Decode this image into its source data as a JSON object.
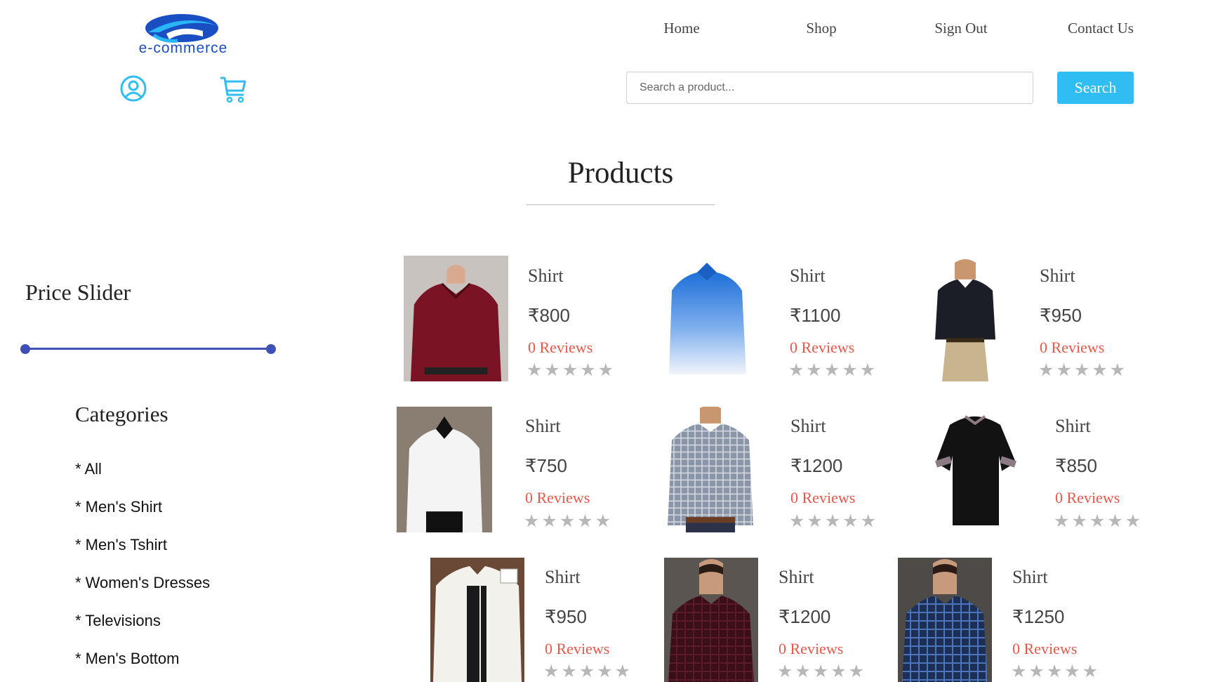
{
  "header": {
    "logo_text": "e-commerce",
    "nav": [
      {
        "label": "Home"
      },
      {
        "label": "Shop"
      },
      {
        "label": "Sign Out"
      },
      {
        "label": "Contact Us"
      }
    ],
    "icons": [
      "user-icon",
      "cart-icon"
    ],
    "search": {
      "placeholder": "Search a product...",
      "value": "",
      "button_label": "Search"
    }
  },
  "page_title": "Products",
  "sidebar": {
    "price_slider_title": "Price Slider",
    "categories_title": "Categories",
    "categories": [
      "* All",
      "* Men's Shirt",
      "* Men's Tshirt",
      "* Women's Dresses",
      "* Televisions",
      "* Men's Bottom"
    ]
  },
  "products": [
    {
      "name": "Shirt",
      "price": "₹800",
      "reviews": "0 Reviews",
      "rating": 0
    },
    {
      "name": "Shirt",
      "price": "₹1100",
      "reviews": "0 Reviews",
      "rating": 0
    },
    {
      "name": "Shirt",
      "price": "₹950",
      "reviews": "0 Reviews",
      "rating": 0
    },
    {
      "name": "Shirt",
      "price": "₹750",
      "reviews": "0 Reviews",
      "rating": 0
    },
    {
      "name": "Shirt",
      "price": "₹1200",
      "reviews": "0 Reviews",
      "rating": 0
    },
    {
      "name": "Shirt",
      "price": "₹850",
      "reviews": "0 Reviews",
      "rating": 0
    },
    {
      "name": "Shirt",
      "price": "₹950",
      "reviews": "0 Reviews",
      "rating": 0
    },
    {
      "name": "Shirt",
      "price": "₹1200",
      "reviews": "0 Reviews",
      "rating": 0
    },
    {
      "name": "Shirt",
      "price": "₹1250",
      "reviews": "0 Reviews",
      "rating": 0
    }
  ],
  "colors": {
    "accent": "#2fbdf2",
    "slider": "#3f51b5",
    "reviews": "#e8584a",
    "stars": "#b7b7b7"
  }
}
